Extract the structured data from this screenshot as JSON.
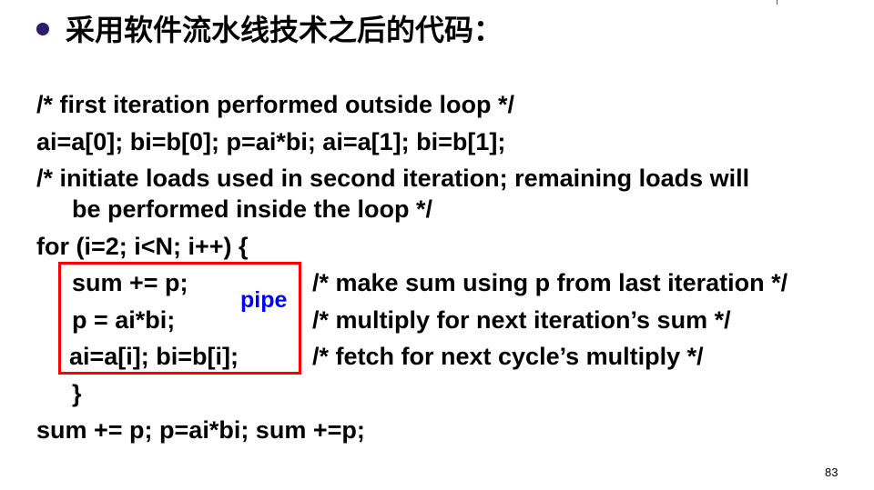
{
  "slide": {
    "title": "采用软件流水线技术之后的代码：",
    "page_number": "83"
  },
  "code": {
    "line1": "/* first iteration performed outside loop */",
    "line2": "ai=a[0]; bi=b[0]; p=ai*bi; ai=a[1]; bi=b[1];",
    "line3a": "/* initiate loads used in second iteration; remaining loads will",
    "line3b": "be performed inside the loop */",
    "line4": "for (i=2; i<N; i++) {",
    "body1_code": "sum += p;",
    "body1_comment": "/* make sum using p from last iteration */",
    "body2_code": "p = ai*bi;",
    "body2_comment": "/* multiply for next iteration’s sum */",
    "body3_code": "ai=a[i]; bi=b[i];",
    "body3_comment": "/* fetch for next cycle’s multiply */",
    "close_brace": "}",
    "line_last": "sum += p; p=ai*bi; sum +=p;"
  },
  "annotation": {
    "pipe_label": "pipe",
    "highlight_color": "#ff0000",
    "label_color": "#0000ff"
  }
}
